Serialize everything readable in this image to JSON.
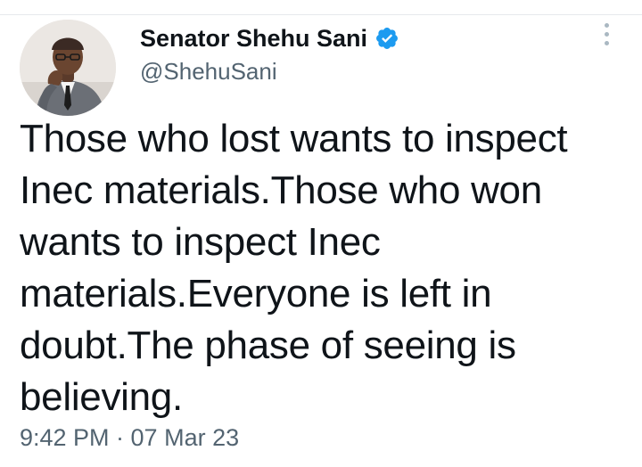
{
  "tweet": {
    "author": {
      "display_name": "Senator Shehu Sani",
      "handle": "@ShehuSani",
      "verified": true,
      "avatar_icon": "avatar-photo"
    },
    "text": "Those who lost wants to inspect Inec materials.Those who won wants to inspect Inec materials.Everyone is left in doubt.The phase of seeing is believing.",
    "timestamp": "9:42 PM · 07 Mar 23",
    "menu_icon": "more-vertical-icon"
  },
  "colors": {
    "text_primary": "#0f1419",
    "text_secondary": "#536471",
    "verified_badge": "#1d9bf0",
    "divider": "#e6e9ec",
    "menu_dots": "#aab8c2"
  }
}
